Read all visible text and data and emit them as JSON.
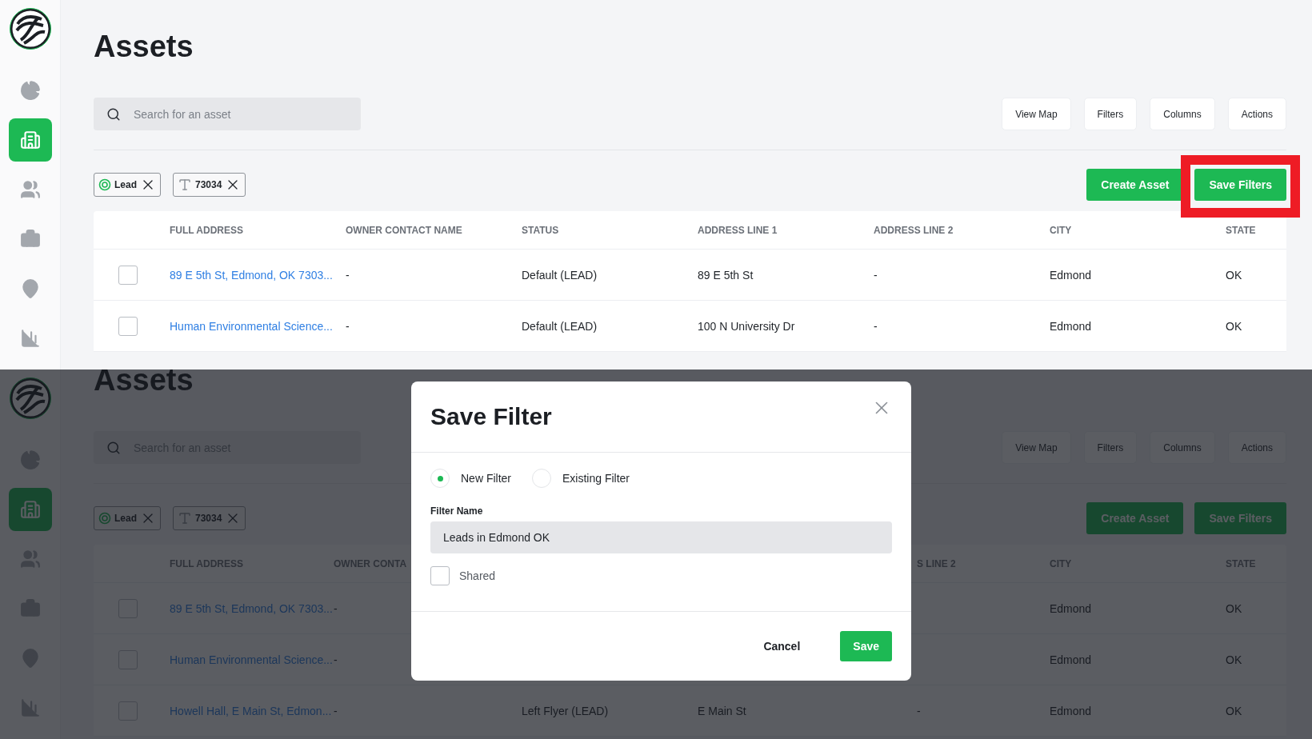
{
  "top_screen": {
    "sidebar": [
      {
        "kind": "pie",
        "selected": false
      },
      {
        "kind": "building",
        "selected": true
      },
      {
        "kind": "people",
        "selected": false
      },
      {
        "kind": "briefcase",
        "selected": false
      },
      {
        "kind": "pin",
        "selected": false
      },
      {
        "kind": "bars",
        "selected": false
      }
    ],
    "title": "Assets",
    "search": {
      "placeholder": "Search for an asset"
    },
    "toolbar": [
      "View Map",
      "Filters",
      "Columns",
      "Actions"
    ],
    "chips": [
      {
        "kind": "status",
        "label": "Lead"
      },
      {
        "kind": "text",
        "label": "73034"
      }
    ],
    "actions": [
      {
        "label": "Create Asset",
        "highlighted": false
      },
      {
        "label": "Save Filters",
        "highlighted": true
      }
    ],
    "table": {
      "columns": [
        "FULL ADDRESS",
        "OWNER CONTACT NAME",
        "STATUS",
        "ADDRESS LINE 1",
        "ADDRESS LINE 2",
        "CITY",
        "STATE"
      ],
      "rows": [
        {
          "checked": false,
          "cells": [
            "89 E 5th St, Edmond, OK 7303...",
            "-",
            "Default (LEAD)",
            "89 E 5th St",
            "-",
            "Edmond",
            "OK"
          ]
        },
        {
          "checked": false,
          "cells": [
            "Human Environmental Science...",
            "-",
            "Default (LEAD)",
            "100 N University Dr",
            "-",
            "Edmond",
            "OK"
          ]
        }
      ]
    }
  },
  "bottom_screen": {
    "sidebar": [
      {
        "kind": "pie",
        "selected": false
      },
      {
        "kind": "building",
        "selected": true
      },
      {
        "kind": "people",
        "selected": false
      },
      {
        "kind": "briefcase",
        "selected": false
      },
      {
        "kind": "pin",
        "selected": false
      },
      {
        "kind": "bars",
        "selected": false
      }
    ],
    "title": "Assets",
    "search": {
      "placeholder": "Search for an asset"
    },
    "toolbar": [
      "View Map",
      "Filters",
      "Columns",
      "Actions"
    ],
    "chips": [
      {
        "kind": "status",
        "label": "Lead"
      },
      {
        "kind": "text",
        "label": "73034"
      }
    ],
    "actions": [
      {
        "label": "Create Asset",
        "highlighted": false
      },
      {
        "label": "Save Filters",
        "highlighted": false
      }
    ],
    "table": {
      "columns": [
        "FULL ADDRESS",
        "OWNER CONTA",
        null,
        null,
        "S LINE 2",
        "CITY",
        "STATE"
      ],
      "rows": [
        {
          "checked": false,
          "cells": [
            "89 E 5th St, Edmond, OK 7303...",
            "-",
            null,
            null,
            null,
            "Edmond",
            "OK"
          ]
        },
        {
          "checked": false,
          "cells": [
            "Human Environmental Science...",
            "-",
            null,
            null,
            null,
            "Edmond",
            "OK"
          ]
        },
        {
          "checked": false,
          "cells": [
            "Howell Hall, E Main St, Edmon...",
            "-",
            "Left Flyer (LEAD)",
            "E Main St",
            "-",
            "Edmond",
            "OK"
          ]
        }
      ]
    },
    "dialog": {
      "title": "Save Filter",
      "options": [
        {
          "label": "New Filter",
          "selected": true
        },
        {
          "label": "Existing Filter",
          "selected": false
        }
      ],
      "field": {
        "label": "Filter Name",
        "value": "Leads in Edmond OK"
      },
      "shared": {
        "label": "Shared",
        "checked": false
      },
      "buttons": [
        {
          "kind": "text",
          "label": "Cancel"
        },
        {
          "kind": "primary",
          "label": "Save"
        }
      ]
    }
  }
}
